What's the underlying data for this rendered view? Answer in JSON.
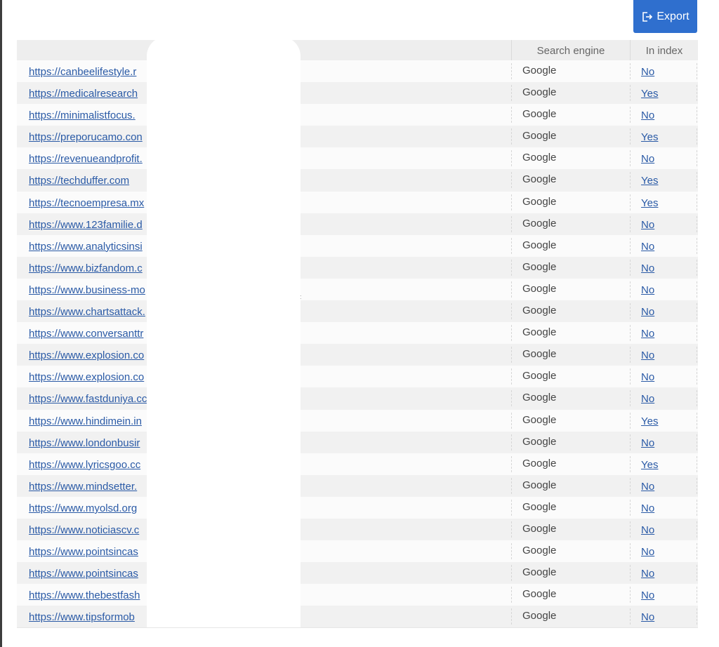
{
  "toolbar": {
    "export_label": "Export",
    "export_icon": "export-icon"
  },
  "table": {
    "headers": {
      "url": "",
      "search_engine": "Search engine",
      "in_index": "In index"
    },
    "rows": [
      {
        "url": "https://canbeelifestyle.r",
        "engine": "Google",
        "in_index": "No"
      },
      {
        "url": "https://medicalresearch",
        "engine": "Google",
        "in_index": "Yes"
      },
      {
        "url": "https://minimalistfocus.",
        "engine": "Google",
        "in_index": "No"
      },
      {
        "url": "https://preporucamo.con",
        "engine": "Google",
        "in_index": "Yes"
      },
      {
        "url": "https://revenueandprofit.",
        "engine": "Google",
        "in_index": "No"
      },
      {
        "url": "https://techduffer.com",
        "engine": "Google",
        "in_index": "Yes"
      },
      {
        "url": "https://tecnoempresa.mx",
        "engine": "Google",
        "in_index": "Yes"
      },
      {
        "url": "https://www.123familie.d",
        "engine": "Google",
        "in_index": "No"
      },
      {
        "url": "https://www.analyticsinsi",
        "engine": "Google",
        "in_index": "No"
      },
      {
        "url": "https://www.bizfandom.c",
        "engine": "Google",
        "in_index": "No"
      },
      {
        "url": "https://www.business-mo",
        "engine": "Google",
        "in_index": "No"
      },
      {
        "url": "https://www.chartsattack.",
        "engine": "Google",
        "in_index": "No"
      },
      {
        "url": "https://www.conversanttr",
        "engine": "Google",
        "in_index": "No"
      },
      {
        "url": "https://www.explosion.co",
        "engine": "Google",
        "in_index": "No"
      },
      {
        "url": "https://www.explosion.co",
        "engine": "Google",
        "in_index": "No"
      },
      {
        "url": "https://www.fastduniya.cc",
        "engine": "Google",
        "in_index": "No"
      },
      {
        "url": "https://www.hindimein.in",
        "engine": "Google",
        "in_index": "Yes"
      },
      {
        "url": "https://www.londonbusir",
        "engine": "Google",
        "in_index": "No"
      },
      {
        "url": "https://www.lyricsgoo.cc",
        "engine": "Google",
        "in_index": "Yes"
      },
      {
        "url": "https://www.mindsetter.",
        "engine": "Google",
        "in_index": "No"
      },
      {
        "url": "https://www.myolsd.org",
        "engine": "Google",
        "in_index": "No"
      },
      {
        "url": "https://www.noticiascv.c",
        "engine": "Google",
        "in_index": "No"
      },
      {
        "url": "https://www.pointsincas",
        "engine": "Google",
        "in_index": "No"
      },
      {
        "url": "https://www.pointsincas",
        "engine": "Google",
        "in_index": "No"
      },
      {
        "url": "https://www.thebestfash",
        "engine": "Google",
        "in_index": "No"
      },
      {
        "url": "https://www.tipsformob",
        "engine": "Google",
        "in_index": "No"
      }
    ]
  },
  "colors": {
    "accent": "#2f6fce",
    "link": "#2a5aa6",
    "header_bg": "#eeeeee"
  }
}
